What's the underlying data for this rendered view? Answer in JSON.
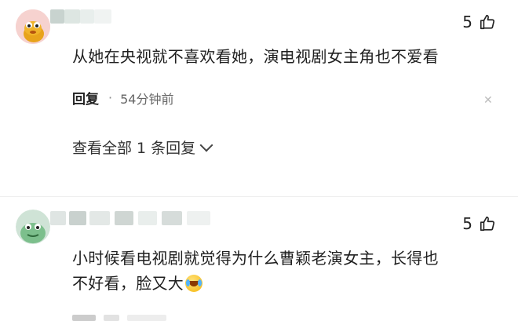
{
  "comments": [
    {
      "likes": "5",
      "text": "从她在央视就不喜欢看她，演电视剧女主角也不爱看",
      "reply_label": "回复",
      "separator": "·",
      "time": "54分钟前",
      "close_glyph": "✕",
      "view_replies": "查看全部 1 条回复"
    },
    {
      "likes": "5",
      "text_line1": "小时候看电视剧就觉得为什么曹颖老演女主，长得也",
      "text_line2": "不好看，脸又大"
    }
  ],
  "icons": {
    "like": "thumbs-up-icon",
    "close": "close-icon",
    "chevron": "chevron-down-icon",
    "emoji": "crying-laughing-emoji"
  },
  "colors": {
    "text": "#1f1f1f",
    "meta": "#666666",
    "divider": "#eeeeee"
  }
}
